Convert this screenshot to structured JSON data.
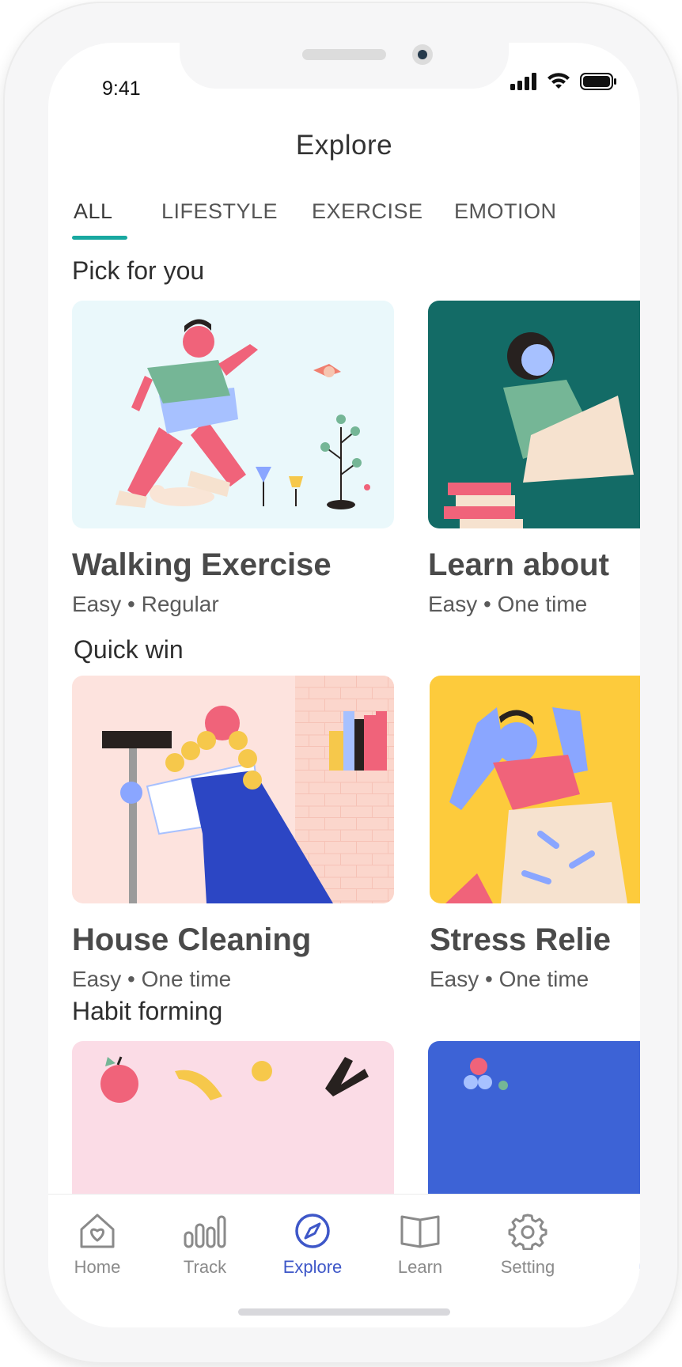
{
  "status": {
    "time": "9:41"
  },
  "header": {
    "title": "Explore"
  },
  "tabs": [
    {
      "label": "ALL",
      "active": true
    },
    {
      "label": "LIFESTYLE",
      "active": false
    },
    {
      "label": "EXERCISE",
      "active": false
    },
    {
      "label": "EMOTION",
      "active": false
    }
  ],
  "sections": [
    {
      "title": "Pick for you",
      "cards": [
        {
          "title": "Walking Exercise",
          "meta": "Easy • Regular",
          "image": "walking-illustration",
          "bg": "#eaf8fb"
        },
        {
          "title": "Learn about",
          "meta": "Easy • One time",
          "image": "reading-illustration",
          "bg": "#136b66"
        }
      ]
    },
    {
      "title": "Quick win",
      "cards": [
        {
          "title": "House Cleaning",
          "meta": "Easy • One time",
          "image": "cleaning-illustration",
          "bg": "#fde3de"
        },
        {
          "title": "Stress Relie",
          "meta": "Easy • One time",
          "image": "stress-illustration",
          "bg": "#fdcb3c"
        }
      ]
    },
    {
      "title": "Habit forming",
      "cards": [
        {
          "image": "fruit-illustration",
          "bg": "#fbdce6"
        },
        {
          "image": "habit-illustration",
          "bg": "#3d63d6"
        }
      ]
    }
  ],
  "bottom_nav": [
    {
      "label": "Home",
      "icon": "home-icon",
      "active": false
    },
    {
      "label": "Track",
      "icon": "bar-chart-icon",
      "active": false
    },
    {
      "label": "Explore",
      "icon": "compass-icon",
      "active": true
    },
    {
      "label": "Learn",
      "icon": "book-icon",
      "active": false
    },
    {
      "label": "Setting",
      "icon": "gear-icon",
      "active": false
    }
  ],
  "colors": {
    "accent_teal": "#18a8a0",
    "accent_blue": "#3e57c8",
    "inactive_gray": "#8a8a8a"
  }
}
